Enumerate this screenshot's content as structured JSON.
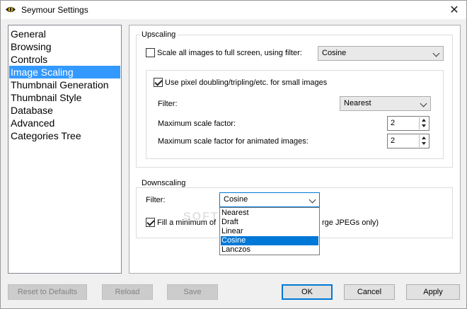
{
  "window": {
    "title": "Seymour Settings",
    "close_glyph": "✕",
    "app_icon": "eye-icon"
  },
  "sidebar": {
    "items": [
      {
        "label": "General"
      },
      {
        "label": "Browsing"
      },
      {
        "label": "Controls"
      },
      {
        "label": "Image Scaling",
        "selected": true
      },
      {
        "label": "Thumbnail Generation"
      },
      {
        "label": "Thumbnail Style"
      },
      {
        "label": "Database"
      },
      {
        "label": "Advanced"
      },
      {
        "label": "Categories Tree"
      }
    ]
  },
  "upscaling": {
    "title": "Upscaling",
    "scale_all": {
      "label": "Scale all images to full screen, using filter:",
      "checked": false,
      "filter": "Cosine"
    },
    "pixel_doubling": {
      "label": "Use pixel doubling/tripling/etc. for small images",
      "checked": true
    },
    "filter": {
      "label": "Filter:",
      "value": "Nearest"
    },
    "max_scale": {
      "label": "Maximum scale factor:",
      "value": "2"
    },
    "max_scale_animated": {
      "label": "Maximum scale factor for animated images:",
      "value": "2"
    }
  },
  "downscaling": {
    "title": "Downscaling",
    "filter": {
      "label": "Filter:",
      "value": "Cosine",
      "options": [
        "Nearest",
        "Draft",
        "Linear",
        "Cosine",
        "Lanczos"
      ],
      "selected_option": "Cosine"
    },
    "fill_minimum": {
      "label_start": "Fill a minimum of",
      "label_end": "rge JPEGs only)",
      "checked": true
    }
  },
  "watermark": "SOFTPEDIA",
  "buttons": {
    "reset": "Reset to Defaults",
    "reload": "Reload",
    "save": "Save",
    "ok": "OK",
    "cancel": "Cancel",
    "apply": "Apply"
  }
}
